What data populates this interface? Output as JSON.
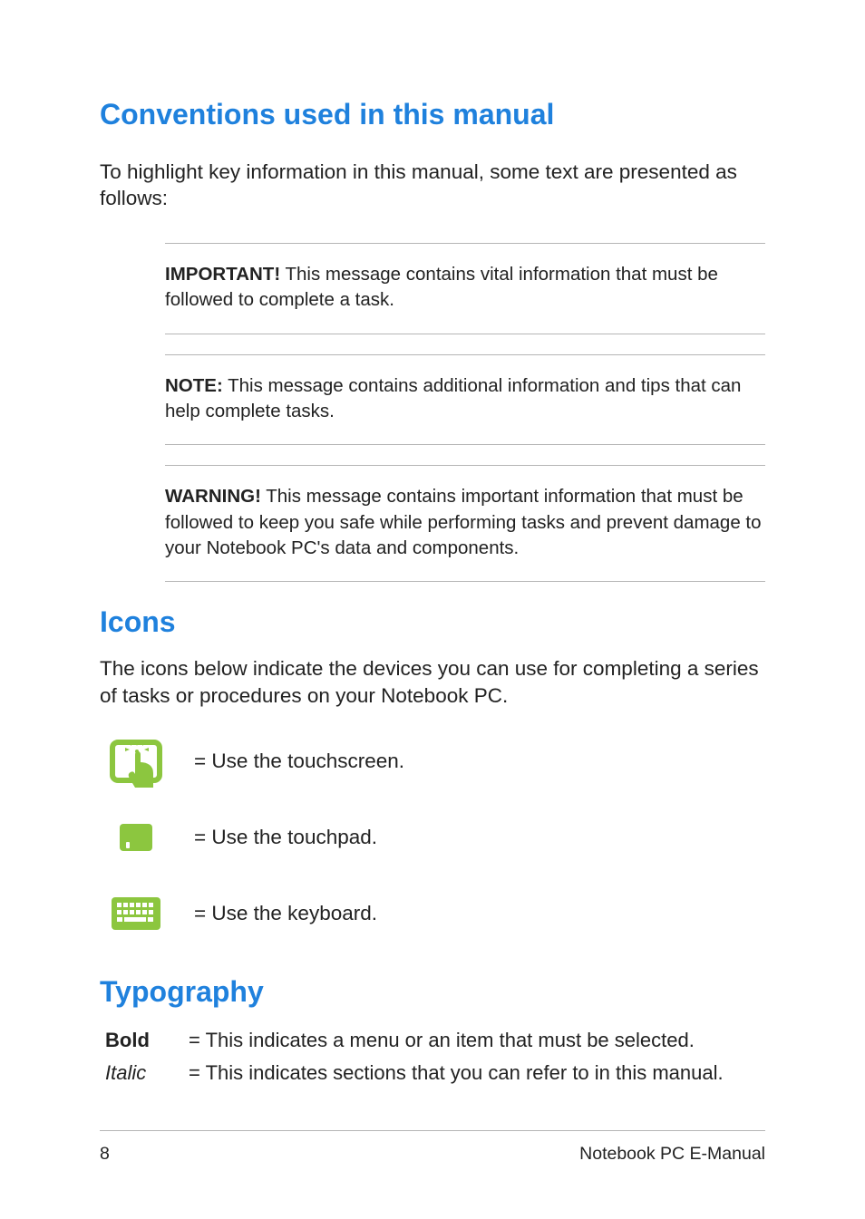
{
  "headings": {
    "conventions": "Conventions used in this manual",
    "icons": "Icons",
    "typography": "Typography"
  },
  "intro_conventions": "To highlight key information in this manual, some text are presented as follows:",
  "callouts": {
    "important_label": "IMPORTANT!",
    "important_text": " This message contains vital information that must be followed to complete a task.",
    "note_label": "NOTE:",
    "note_text": " This message contains additional information and tips that can help complete tasks.",
    "warning_label": "WARNING!",
    "warning_text": " This message contains important information that must be followed to keep you safe while performing tasks and prevent damage to your Notebook PC's data and components."
  },
  "intro_icons": "The icons below indicate the devices you can use for completing a series of tasks or procedures on your Notebook PC.",
  "icon_rows": {
    "touchscreen": "= Use the touchscreen.",
    "touchpad": "= Use the touchpad.",
    "keyboard": "= Use the keyboard."
  },
  "typography_rows": {
    "bold_label": "Bold",
    "bold_desc": "= This indicates a menu or an item that must be selected.",
    "italic_label": "Italic",
    "italic_desc": "= This indicates sections that you can refer to in this manual."
  },
  "footer": {
    "page_number": "8",
    "doc_title": "Notebook PC E-Manual"
  },
  "colors": {
    "accent_green": "#8cc63f",
    "accent_blue": "#1f81dd"
  }
}
